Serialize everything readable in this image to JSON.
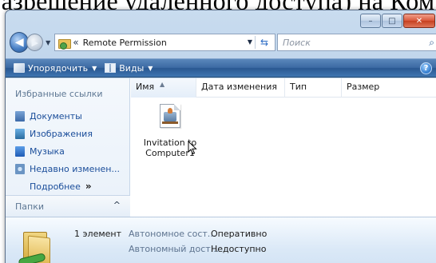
{
  "page": {
    "background_heading": "азрешение удаленного доступа) на Ком"
  },
  "window": {
    "caption_buttons": {
      "minimize": "–",
      "maximize": "□",
      "close": "✕"
    }
  },
  "nav": {
    "back_icon": "back-arrow-icon",
    "forward_icon": "forward-arrow-icon",
    "address_prefix": "«",
    "address_path": "Remote Permission",
    "search_placeholder": "Поиск"
  },
  "toolbar": {
    "organize_label": "Упорядочить",
    "views_label": "Виды",
    "help_label": "?"
  },
  "navpane": {
    "title": "Избранные ссылки",
    "links": [
      {
        "label": "Документы",
        "icon": "documents-icon"
      },
      {
        "label": "Изображения",
        "icon": "pictures-icon"
      },
      {
        "label": "Музыка",
        "icon": "music-icon"
      },
      {
        "label": "Недавно изменен...",
        "icon": "recent-icon"
      }
    ],
    "more_label": "Подробнее",
    "more_chevron": "»",
    "folders_label": "Папки",
    "folders_caret": "^"
  },
  "filepane": {
    "columns": [
      "Имя",
      "Дата изменения",
      "Тип",
      "Размер"
    ],
    "items": [
      {
        "name_line1": "Invitation to",
        "name_line2": "Computer1",
        "icon": "remote-assistance-invitation-icon"
      }
    ]
  },
  "details": {
    "count": "1 элемент",
    "status_label": "Автономное сост...",
    "status_value": "Оперативно",
    "availability_label": "Автономный дост...",
    "availability_value": "Недоступно"
  }
}
